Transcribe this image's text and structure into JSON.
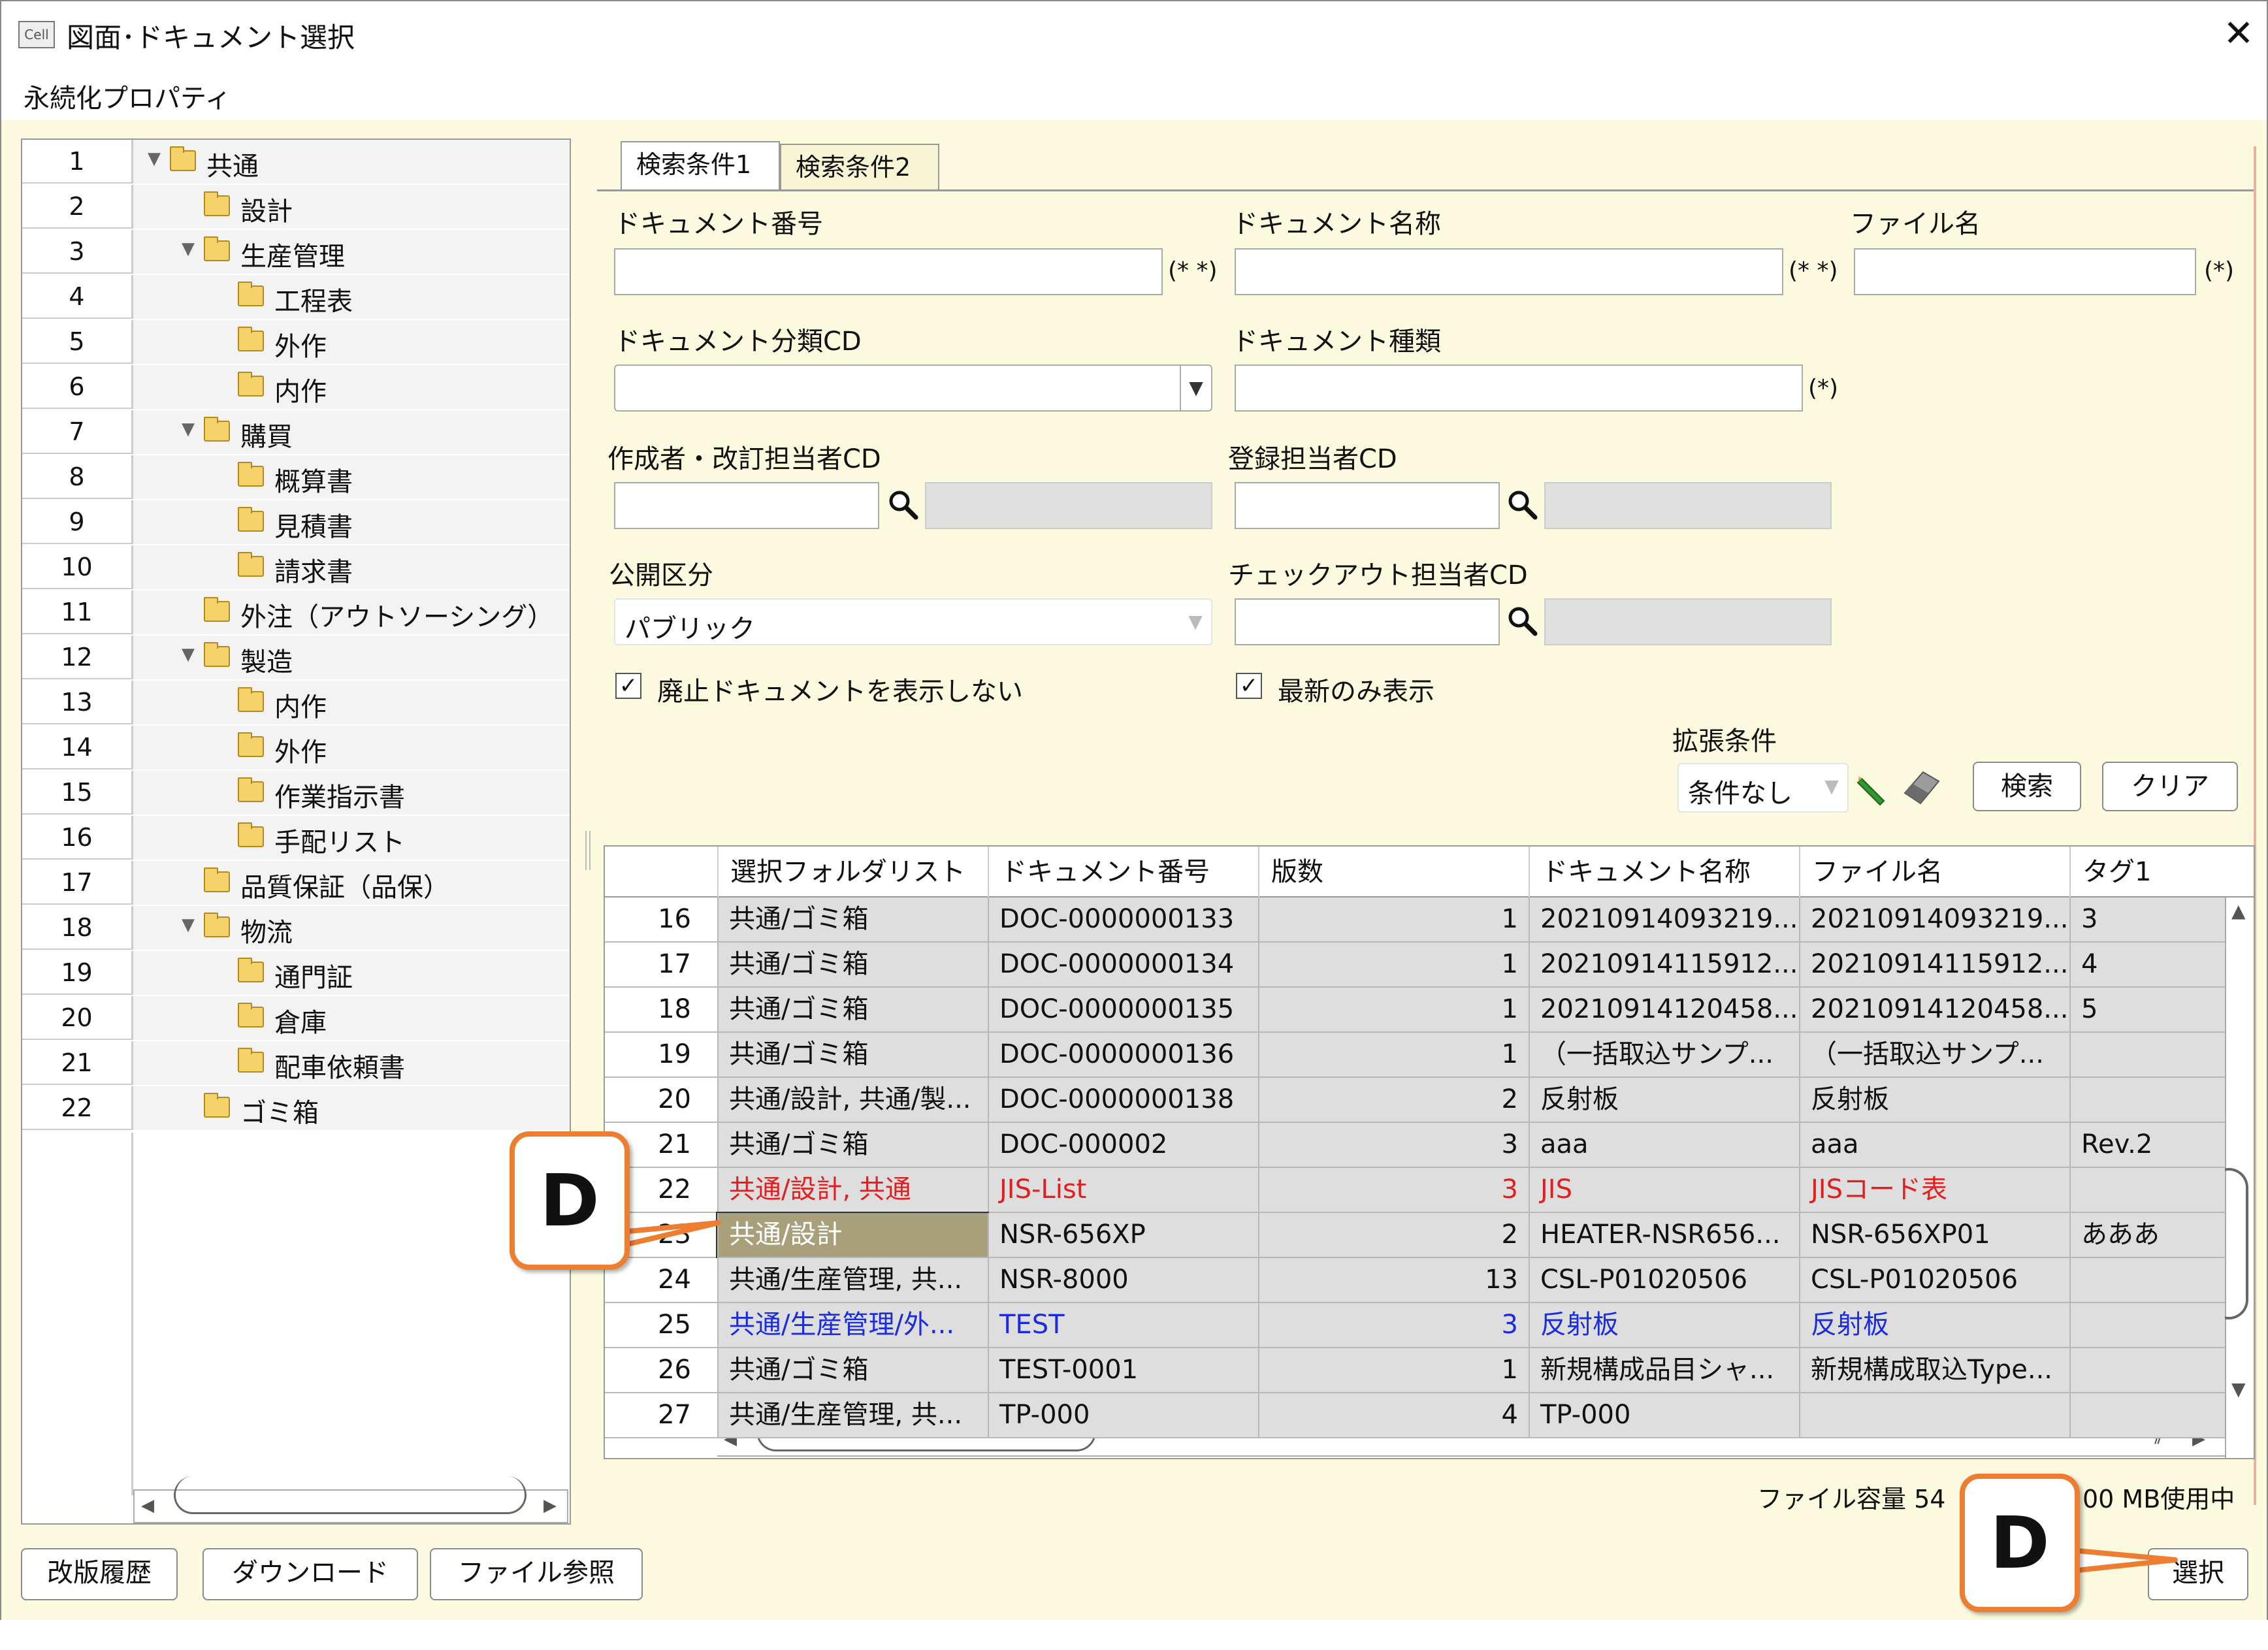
{
  "window": {
    "app_icon_text": "Cell",
    "title": "図面･ドキュメント選択",
    "close_glyph": "✕"
  },
  "menu": {
    "item": "永続化プロパティ"
  },
  "tree": {
    "rows": [
      {
        "num": "1",
        "label": "共通",
        "expanded": true
      },
      {
        "num": "2",
        "label": "設計"
      },
      {
        "num": "3",
        "label": "生産管理",
        "expanded": true
      },
      {
        "num": "4",
        "label": "工程表"
      },
      {
        "num": "5",
        "label": "外作"
      },
      {
        "num": "6",
        "label": "内作"
      },
      {
        "num": "7",
        "label": "購買",
        "expanded": true
      },
      {
        "num": "8",
        "label": "概算書"
      },
      {
        "num": "9",
        "label": "見積書"
      },
      {
        "num": "10",
        "label": "請求書"
      },
      {
        "num": "11",
        "label": "外注（アウトソーシング）"
      },
      {
        "num": "12",
        "label": "製造",
        "expanded": true
      },
      {
        "num": "13",
        "label": "内作"
      },
      {
        "num": "14",
        "label": "外作"
      },
      {
        "num": "15",
        "label": "作業指示書"
      },
      {
        "num": "16",
        "label": "手配リスト"
      },
      {
        "num": "17",
        "label": "品質保証（品保）"
      },
      {
        "num": "18",
        "label": "物流",
        "expanded": true
      },
      {
        "num": "19",
        "label": "通門証"
      },
      {
        "num": "20",
        "label": "倉庫"
      },
      {
        "num": "21",
        "label": "配車依頼書"
      },
      {
        "num": "22",
        "label": "ゴミ箱"
      }
    ]
  },
  "tabs": [
    {
      "label": "検索条件1",
      "active": true
    },
    {
      "label": "検索条件2"
    }
  ],
  "form": {
    "doc_number_label": "ドキュメント番号",
    "doc_number_value": "",
    "doc_number_hint": "(* *)",
    "doc_name_label": "ドキュメント名称",
    "doc_name_value": "",
    "doc_name_hint": "(* *)",
    "file_name_label": "ファイル名",
    "file_name_value": "",
    "file_name_hint": "(*)",
    "category_label": "ドキュメント分類CD",
    "category_value": "",
    "doc_type_label": "ドキュメント種類",
    "doc_type_value": "",
    "doc_type_hint": "(*)",
    "creator_label": "作成者・改訂担当者CD",
    "creator_value": "",
    "registrant_label": "登録担当者CD",
    "registrant_value": "",
    "publish_label": "公開区分",
    "publish_value": "パブリック",
    "checkout_label": "チェックアウト担当者CD",
    "checkout_value": "",
    "hide_obsolete_label": "廃止ドキュメントを表示しない",
    "hide_obsolete_checked": "✓",
    "latest_only_label": "最新のみ表示",
    "latest_only_checked": "✓",
    "ext_label": "拡張条件",
    "ext_value": "条件なし",
    "search_button": "検索",
    "clear_button": "クリア"
  },
  "grid": {
    "columns": [
      "選択フォルダリスト",
      "ドキュメント番号",
      "版数",
      "ドキュメント名称",
      "ファイル名",
      "タグ1"
    ],
    "rows": [
      {
        "num": "16",
        "folder": "共通/ゴミ箱",
        "doc": "DOC-0000000133",
        "ver": "1",
        "name": "20210914093219...",
        "file": "20210914093219...",
        "tag": "3",
        "color": "#111111"
      },
      {
        "num": "17",
        "folder": "共通/ゴミ箱",
        "doc": "DOC-0000000134",
        "ver": "1",
        "name": "20210914115912...",
        "file": "20210914115912...",
        "tag": "4",
        "color": "#111111"
      },
      {
        "num": "18",
        "folder": "共通/ゴミ箱",
        "doc": "DOC-0000000135",
        "ver": "1",
        "name": "20210914120458...",
        "file": "20210914120458...",
        "tag": "5",
        "color": "#111111"
      },
      {
        "num": "19",
        "folder": "共通/ゴミ箱",
        "doc": "DOC-0000000136",
        "ver": "1",
        "name": "（一括取込サンプ...",
        "file": "（一括取込サンプ...",
        "tag": "",
        "color": "#111111"
      },
      {
        "num": "20",
        "folder": "共通/設計, 共通/製...",
        "doc": "DOC-0000000138",
        "ver": "2",
        "name": "反射板",
        "file": "反射板",
        "tag": "",
        "color": "#111111"
      },
      {
        "num": "21",
        "folder": "共通/ゴミ箱",
        "doc": "DOC-000002",
        "ver": "3",
        "name": "aaa",
        "file": "aaa",
        "tag": "Rev.2",
        "color": "#111111"
      },
      {
        "num": "22",
        "folder": "共通/設計, 共通",
        "doc": "JIS-List",
        "ver": "3",
        "name": "JIS",
        "file": "JISコード表",
        "tag": "",
        "color": "#e02020"
      },
      {
        "num": "23",
        "folder": "共通/設計",
        "doc": "NSR-656XP",
        "ver": "2",
        "name": "HEATER-NSR656...",
        "file": "NSR-656XP01",
        "tag": "あああ",
        "color": "#111111",
        "selected": true
      },
      {
        "num": "24",
        "folder": "共通/生産管理, 共...",
        "doc": "NSR-8000",
        "ver": "13",
        "name": "CSL-P01020506",
        "file": "CSL-P01020506",
        "tag": "",
        "color": "#111111"
      },
      {
        "num": "25",
        "folder": "共通/生産管理/外...",
        "doc": "TEST",
        "ver": "3",
        "name": "反射板",
        "file": "反射板",
        "tag": "",
        "color": "#1a2be0"
      },
      {
        "num": "26",
        "folder": "共通/ゴミ箱",
        "doc": "TEST-0001",
        "ver": "1",
        "name": "新規構成品目シャ...",
        "file": "新規構成取込Type...",
        "tag": "",
        "color": "#111111"
      },
      {
        "num": "27",
        "folder": "共通/生産管理, 共...",
        "doc": "TP-000",
        "ver": "4",
        "name": "TP-000",
        "file": "",
        "tag": "",
        "color": "#111111"
      }
    ]
  },
  "capacity_text": "ファイル容量 54",
  "capacity_tail": "00 MB使用中",
  "bottom_buttons": {
    "history": "改版履歴",
    "download": "ダウンロード",
    "file_ref": "ファイル参照",
    "select": "選択"
  },
  "callouts": [
    "D",
    "D"
  ],
  "colors": {
    "accent": "#ed7d31",
    "panel_bg": "#fbfadf",
    "selected_cell": "#a8a07a"
  }
}
